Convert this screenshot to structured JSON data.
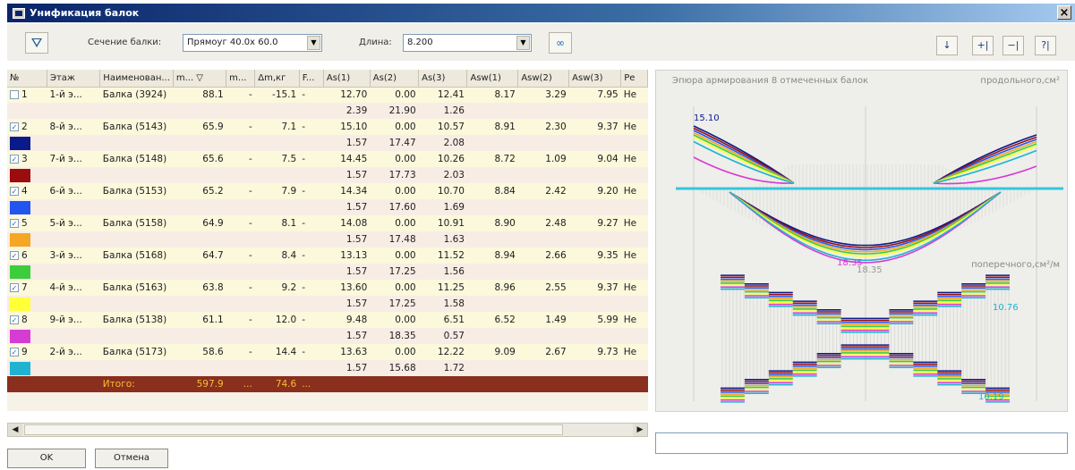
{
  "window": {
    "title": "Унификация балок",
    "close": "×"
  },
  "toolbar": {
    "section_label": "Сечение балки:",
    "section_value": "Прямоуг 40.0x 60.0",
    "length_label": "Длина:",
    "length_value": "8.200",
    "right_buttons": [
      "↓",
      "+|",
      "−|",
      "?|"
    ]
  },
  "table": {
    "columns": [
      "№",
      "Этаж",
      "Наименован...",
      "m... ▽",
      "m...",
      "Δm,кг",
      "F...",
      "As(1)",
      "As(2)",
      "As(3)",
      "Asw(1)",
      "Asw(2)",
      "Asw(3)",
      "Ре"
    ],
    "rows": [
      {
        "num": "1",
        "checked": false,
        "floor": "1-й э...",
        "name": "Балка (3924)",
        "m1": "88.1",
        "m2": "-",
        "dm": "-15.1",
        "f": "-",
        "as1": "12.70",
        "as2": "0.00",
        "as3": "12.41",
        "asw1": "8.17",
        "asw2": "3.29",
        "asw3": "7.95",
        "re": "Не",
        "as1b": "2.39",
        "as2b": "21.90",
        "as3b": "1.26",
        "color": ""
      },
      {
        "num": "2",
        "checked": true,
        "floor": "8-й э...",
        "name": "Балка (5143)",
        "m1": "65.9",
        "m2": "-",
        "dm": "7.1",
        "f": "-",
        "as1": "15.10",
        "as2": "0.00",
        "as3": "10.57",
        "asw1": "8.91",
        "asw2": "2.30",
        "asw3": "9.37",
        "re": "Не",
        "as1b": "1.57",
        "as2b": "17.47",
        "as3b": "2.08",
        "color": "#0b1a8a"
      },
      {
        "num": "3",
        "checked": true,
        "floor": "7-й э...",
        "name": "Балка (5148)",
        "m1": "65.6",
        "m2": "-",
        "dm": "7.5",
        "f": "-",
        "as1": "14.45",
        "as2": "0.00",
        "as3": "10.26",
        "asw1": "8.72",
        "asw2": "1.09",
        "asw3": "9.04",
        "re": "Не",
        "as1b": "1.57",
        "as2b": "17.73",
        "as3b": "2.03",
        "color": "#9b0c0c"
      },
      {
        "num": "4",
        "checked": true,
        "floor": "6-й э...",
        "name": "Балка (5153)",
        "m1": "65.2",
        "m2": "-",
        "dm": "7.9",
        "f": "-",
        "as1": "14.34",
        "as2": "0.00",
        "as3": "10.70",
        "asw1": "8.84",
        "asw2": "2.42",
        "asw3": "9.20",
        "re": "Не",
        "as1b": "1.57",
        "as2b": "17.60",
        "as3b": "1.69",
        "color": "#2255ee"
      },
      {
        "num": "5",
        "checked": true,
        "floor": "5-й э...",
        "name": "Балка (5158)",
        "m1": "64.9",
        "m2": "-",
        "dm": "8.1",
        "f": "-",
        "as1": "14.08",
        "as2": "0.00",
        "as3": "10.91",
        "asw1": "8.90",
        "asw2": "2.48",
        "asw3": "9.27",
        "re": "Не",
        "as1b": "1.57",
        "as2b": "17.48",
        "as3b": "1.63",
        "color": "#f5a623"
      },
      {
        "num": "6",
        "checked": true,
        "floor": "3-й э...",
        "name": "Балка (5168)",
        "m1": "64.7",
        "m2": "-",
        "dm": "8.4",
        "f": "-",
        "as1": "13.13",
        "as2": "0.00",
        "as3": "11.52",
        "asw1": "8.94",
        "asw2": "2.66",
        "asw3": "9.35",
        "re": "Не",
        "as1b": "1.57",
        "as2b": "17.25",
        "as3b": "1.56",
        "color": "#3ccd3c"
      },
      {
        "num": "7",
        "checked": true,
        "floor": "4-й э...",
        "name": "Балка (5163)",
        "m1": "63.8",
        "m2": "-",
        "dm": "9.2",
        "f": "-",
        "as1": "13.60",
        "as2": "0.00",
        "as3": "11.25",
        "asw1": "8.96",
        "asw2": "2.55",
        "asw3": "9.37",
        "re": "Не",
        "as1b": "1.57",
        "as2b": "17.25",
        "as3b": "1.58",
        "color": "#ffff3a"
      },
      {
        "num": "8",
        "checked": true,
        "floor": "9-й э...",
        "name": "Балка (5138)",
        "m1": "61.1",
        "m2": "-",
        "dm": "12.0",
        "f": "-",
        "as1": "9.48",
        "as2": "0.00",
        "as3": "6.51",
        "asw1": "6.52",
        "asw2": "1.49",
        "asw3": "5.99",
        "re": "Не",
        "as1b": "1.57",
        "as2b": "18.35",
        "as3b": "0.57",
        "color": "#d63cd3"
      },
      {
        "num": "9",
        "checked": true,
        "floor": "2-й э...",
        "name": "Балка (5173)",
        "m1": "58.6",
        "m2": "-",
        "dm": "14.4",
        "f": "-",
        "as1": "13.63",
        "as2": "0.00",
        "as3": "12.22",
        "asw1": "9.09",
        "asw2": "2.67",
        "asw3": "9.73",
        "re": "Не",
        "as1b": "1.57",
        "as2b": "15.68",
        "as3b": "1.72",
        "color": "#1fb3d1"
      }
    ],
    "total": {
      "label": "Итого:",
      "m1": "597.9",
      "m2": "...",
      "dm": "74.6",
      "f": "..."
    }
  },
  "chart": {
    "title": "Эпюра армирования 8 отмеченных балок",
    "unit_long": "продольного,см²",
    "unit_trans": "поперечного,см²/м",
    "label_max_top": "15.10",
    "label_bottom_max": "18.35",
    "label_bottom_other": "18.35",
    "label_trans_max": "10.76",
    "label_trans_min": "10.19",
    "series_colors": [
      "#0b1a8a",
      "#9b0c0c",
      "#2255ee",
      "#f5a623",
      "#3ccd3c",
      "#ffff3a",
      "#d63cd3",
      "#1fb3d1"
    ]
  },
  "buttons": {
    "ok": "OK",
    "cancel": "Отмена"
  }
}
